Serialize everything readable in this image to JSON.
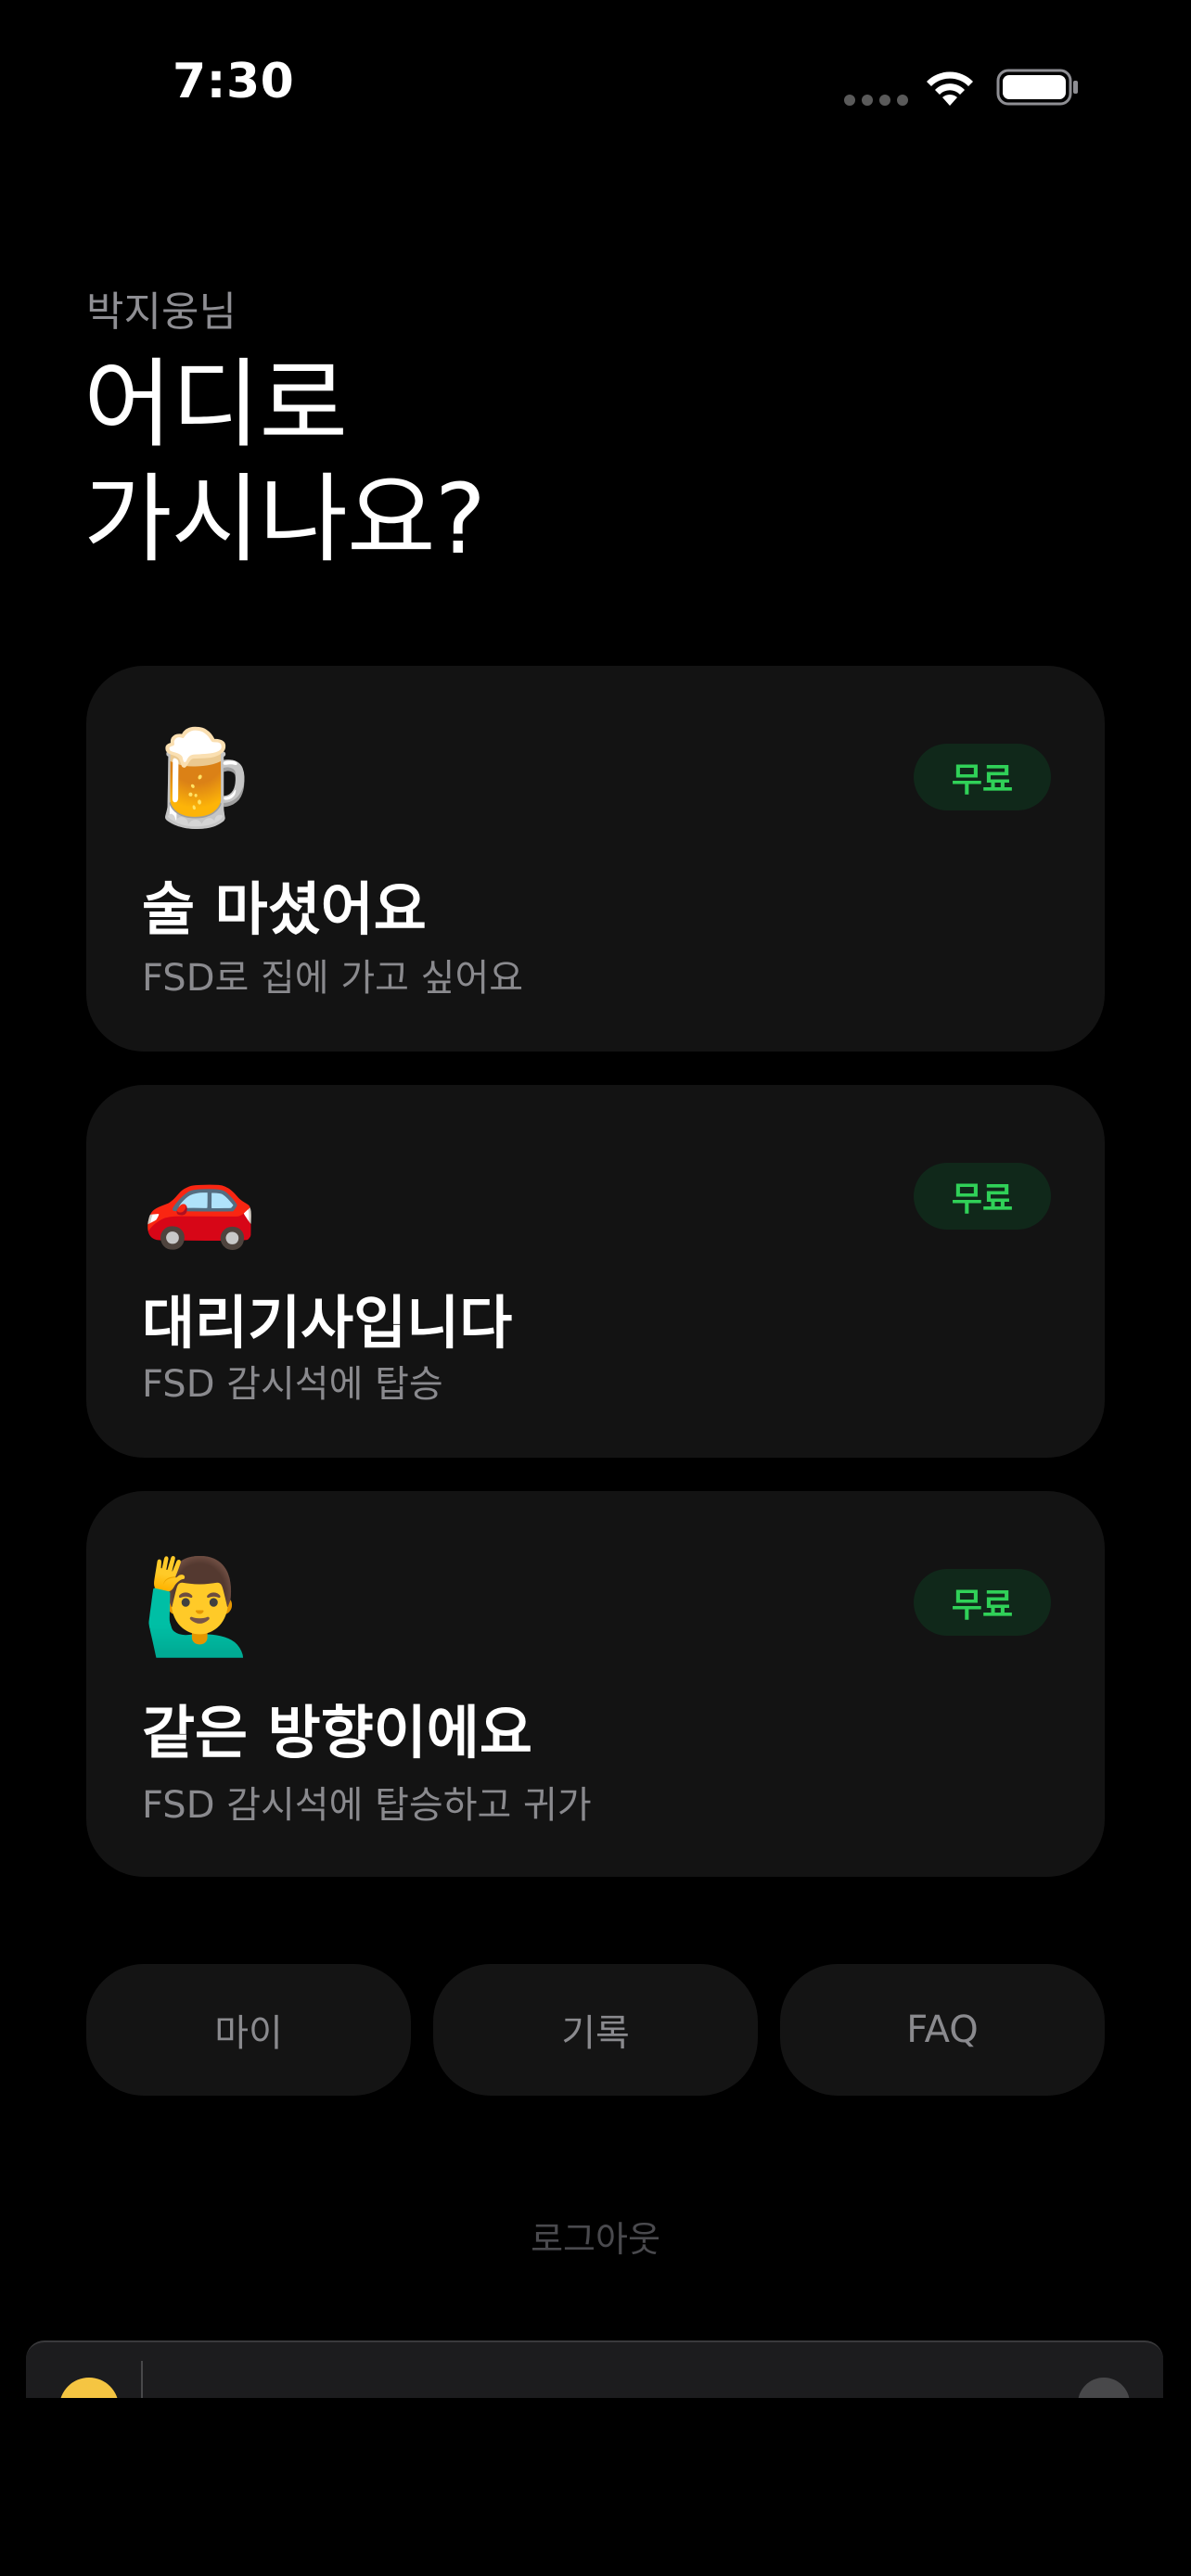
{
  "status_bar": {
    "time": "7:30"
  },
  "header": {
    "greeting": "박지웅님",
    "headline_line1": "어디로",
    "headline_line2": "가시나요?"
  },
  "cards": [
    {
      "emoji": "🍺",
      "icon": "beer-mug-icon",
      "badge": "무료",
      "title": "술 마셨어요",
      "subtitle": "FSD로 집에 가고 싶어요"
    },
    {
      "emoji": "🚗",
      "icon": "car-icon",
      "badge": "무료",
      "title": "대리기사입니다",
      "subtitle": "FSD 감시석에 탑승"
    },
    {
      "emoji": "🙋‍♂️",
      "icon": "person-raising-hand-icon",
      "badge": "무료",
      "title": "같은 방향이에요",
      "subtitle": "FSD 감시석에 탑승하고 귀가"
    }
  ],
  "nav": {
    "my": "마이",
    "history": "기록",
    "faq": "FAQ"
  },
  "logout": "로그아웃",
  "colors": {
    "background": "#000000",
    "card": "#131313",
    "badge_bg": "#10281a",
    "badge_text": "#30d158",
    "muted_text": "#8a8a8e"
  }
}
